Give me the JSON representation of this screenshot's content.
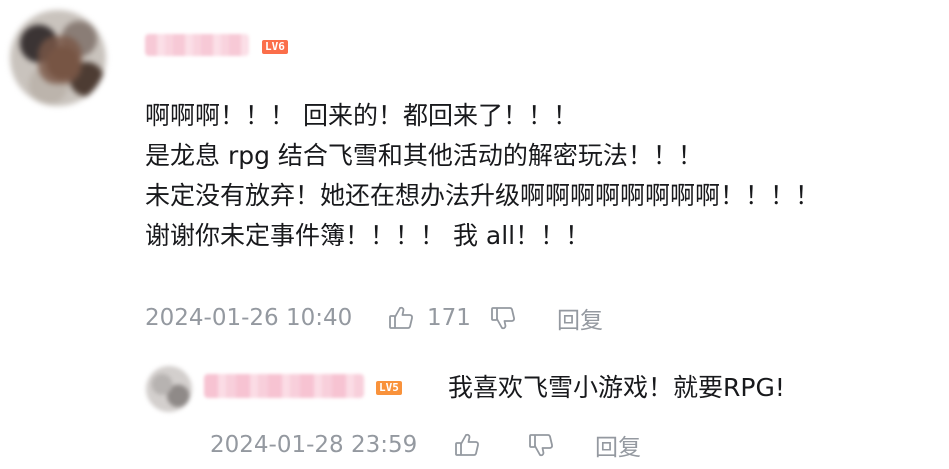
{
  "comment": {
    "level": "LV6",
    "lines": [
      "啊啊啊！！！ 回来的！都回来了！！！",
      "是龙息 rpg 结合飞雪和其他活动的解密玩法！！！",
      "未定没有放弃！她还在想办法升级啊啊啊啊啊啊啊啊！！！！",
      "谢谢你未定事件簿！！！！ 我 all！！！"
    ],
    "timestamp": "2024-01-26 10:40",
    "like_icon": "thumbs-up-icon",
    "like_count": "171",
    "dislike_icon": "thumbs-down-icon",
    "reply_label": "回复"
  },
  "reply": {
    "level": "LV5",
    "text": "我喜欢飞雪小游戏！就要RPG!",
    "timestamp": "2024-01-28 23:59",
    "like_icon": "thumbs-up-icon",
    "dislike_icon": "thumbs-down-icon",
    "reply_label": "回复"
  },
  "colors": {
    "text": "#18191c",
    "meta": "#9499a0",
    "level6": "#fb6e4a",
    "level5": "#f9923b"
  }
}
